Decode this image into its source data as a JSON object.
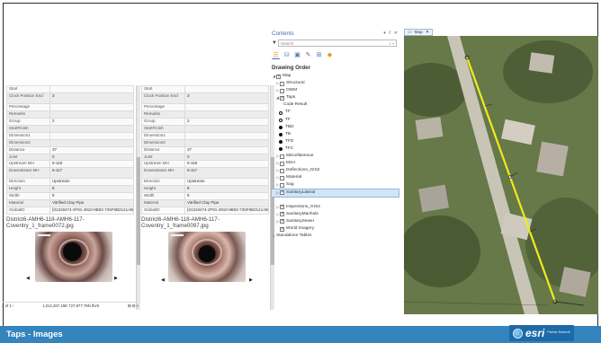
{
  "popup_left": {
    "rows": [
      {
        "key": "Start",
        "value": ""
      },
      {
        "key": "Clock Position End",
        "value": "3"
      },
      {
        "key": "Percentage",
        "value": ""
      },
      {
        "key": "Remarks",
        "value": ""
      },
      {
        "key": "Group",
        "value": "2"
      },
      {
        "key": "StartFinish",
        "value": ""
      },
      {
        "key": "Dimension1",
        "value": ""
      },
      {
        "key": "Dimension2",
        "value": ""
      },
      {
        "key": "Distance",
        "value": "37"
      },
      {
        "key": "Joint",
        "value": "0"
      },
      {
        "key": "Upstream MH",
        "value": "6-118"
      },
      {
        "key": "Downstream MH",
        "value": "6-117"
      },
      {
        "key": "Direction",
        "value": "Upstream"
      },
      {
        "key": "Height",
        "value": "8"
      },
      {
        "key": "Width",
        "value": "8"
      },
      {
        "key": "Material",
        "value": "Vitrified Clay Pipe"
      },
      {
        "key": "GlobalID",
        "value": "{01319474-2F91-4910-9B02-725F9B2121AB}"
      }
    ],
    "caption": "District6-AMH6-118-AMH6-117-Coventry_1_frame0072.jpg",
    "footer_left": "1 of 1 ›",
    "footer_coords": "1,012,267.15E 727,977.78N ftUS",
    "footer_icons": "⊞ ⊟ ⌕"
  },
  "popup_right": {
    "rows": [
      {
        "key": "Start",
        "value": ""
      },
      {
        "key": "Clock Position End",
        "value": "3"
      },
      {
        "key": "Percentage",
        "value": ""
      },
      {
        "key": "Remarks",
        "value": ""
      },
      {
        "key": "Group",
        "value": "2"
      },
      {
        "key": "StartFinish",
        "value": ""
      },
      {
        "key": "Dimension1",
        "value": ""
      },
      {
        "key": "Dimension2",
        "value": ""
      },
      {
        "key": "Distance",
        "value": "37"
      },
      {
        "key": "Joint",
        "value": "0"
      },
      {
        "key": "Upstream MH",
        "value": "6-118"
      },
      {
        "key": "Downstream MH",
        "value": "6-117"
      },
      {
        "key": "Direction",
        "value": "Upstream"
      },
      {
        "key": "Height",
        "value": "8"
      },
      {
        "key": "Width",
        "value": "8"
      },
      {
        "key": "Material",
        "value": "Vitrified Clay Pipe"
      },
      {
        "key": "GlobalID",
        "value": "{01319474-2F91-4910-9B02-725F9B2121AB}"
      }
    ],
    "caption": "District6-AMH6-118-AMH6-117-Coventry_1_frame0097.jpg"
  },
  "contents": {
    "title": "Contents",
    "window_buttons": "▾ ⫽ ✕",
    "search_placeholder": "Search",
    "search_icon": "⌕ ▾",
    "drawing_order": "Drawing Order",
    "layers": [
      {
        "label": "Map",
        "checked": true,
        "expand": "◢",
        "indent": 0
      },
      {
        "label": "Structural",
        "checked": false,
        "expand": "▷",
        "indent": 1
      },
      {
        "label": "OWM",
        "checked": false,
        "expand": "▷",
        "indent": 1
      },
      {
        "label": "Taps",
        "checked": true,
        "expand": "◢",
        "indent": 1
      },
      {
        "label": "Code Result",
        "checked": null,
        "expand": "",
        "indent": 2
      },
      {
        "label": "TF",
        "legend": "hollow",
        "indent": 2
      },
      {
        "label": "TF",
        "legend": "hollow",
        "indent": 2
      },
      {
        "label": "TBD",
        "legend": "solid",
        "indent": 2
      },
      {
        "label": "TB",
        "legend": "solid",
        "indent": 2
      },
      {
        "label": "TFD",
        "legend": "solid",
        "indent": 2
      },
      {
        "label": "TFC",
        "legend": "solid",
        "indent": 2
      },
      {
        "label": "Miscellaneous",
        "checked": false,
        "expand": "▷",
        "indent": 1
      },
      {
        "label": "MSA",
        "checked": false,
        "expand": "▷",
        "indent": 1
      },
      {
        "label": "Deflections_GIS2",
        "checked": false,
        "expand": "▷",
        "indent": 1
      },
      {
        "label": "Material",
        "checked": false,
        "expand": "▷",
        "indent": 1
      },
      {
        "label": "Sag",
        "checked": false,
        "expand": "▷",
        "indent": 1
      },
      {
        "label": "SanitaryLateral",
        "checked": true,
        "expand": "▷",
        "indent": 1,
        "selected": true
      },
      {
        "label": "",
        "spacer": true
      },
      {
        "label": "Inspections_GIS2",
        "checked": true,
        "expand": "▷",
        "indent": 1
      },
      {
        "label": "SanitaryManhole",
        "checked": true,
        "expand": "▷",
        "indent": 1
      },
      {
        "label": "SanitarySewer",
        "checked": true,
        "expand": "▷",
        "indent": 1
      },
      {
        "label": "World Imagery",
        "checked": true,
        "expand": "",
        "indent": 1
      },
      {
        "label": "Standalone Tables",
        "checked": null,
        "expand": "▷",
        "indent": 0
      }
    ]
  },
  "map": {
    "tab_label": "Map",
    "tab_close": "✕",
    "line_color": "#f2ea1c"
  },
  "footer": {
    "title": "Taps - Images",
    "logo_word": "esri",
    "logo_tag": "Partner Network",
    "bar_color": "#3484bd"
  }
}
